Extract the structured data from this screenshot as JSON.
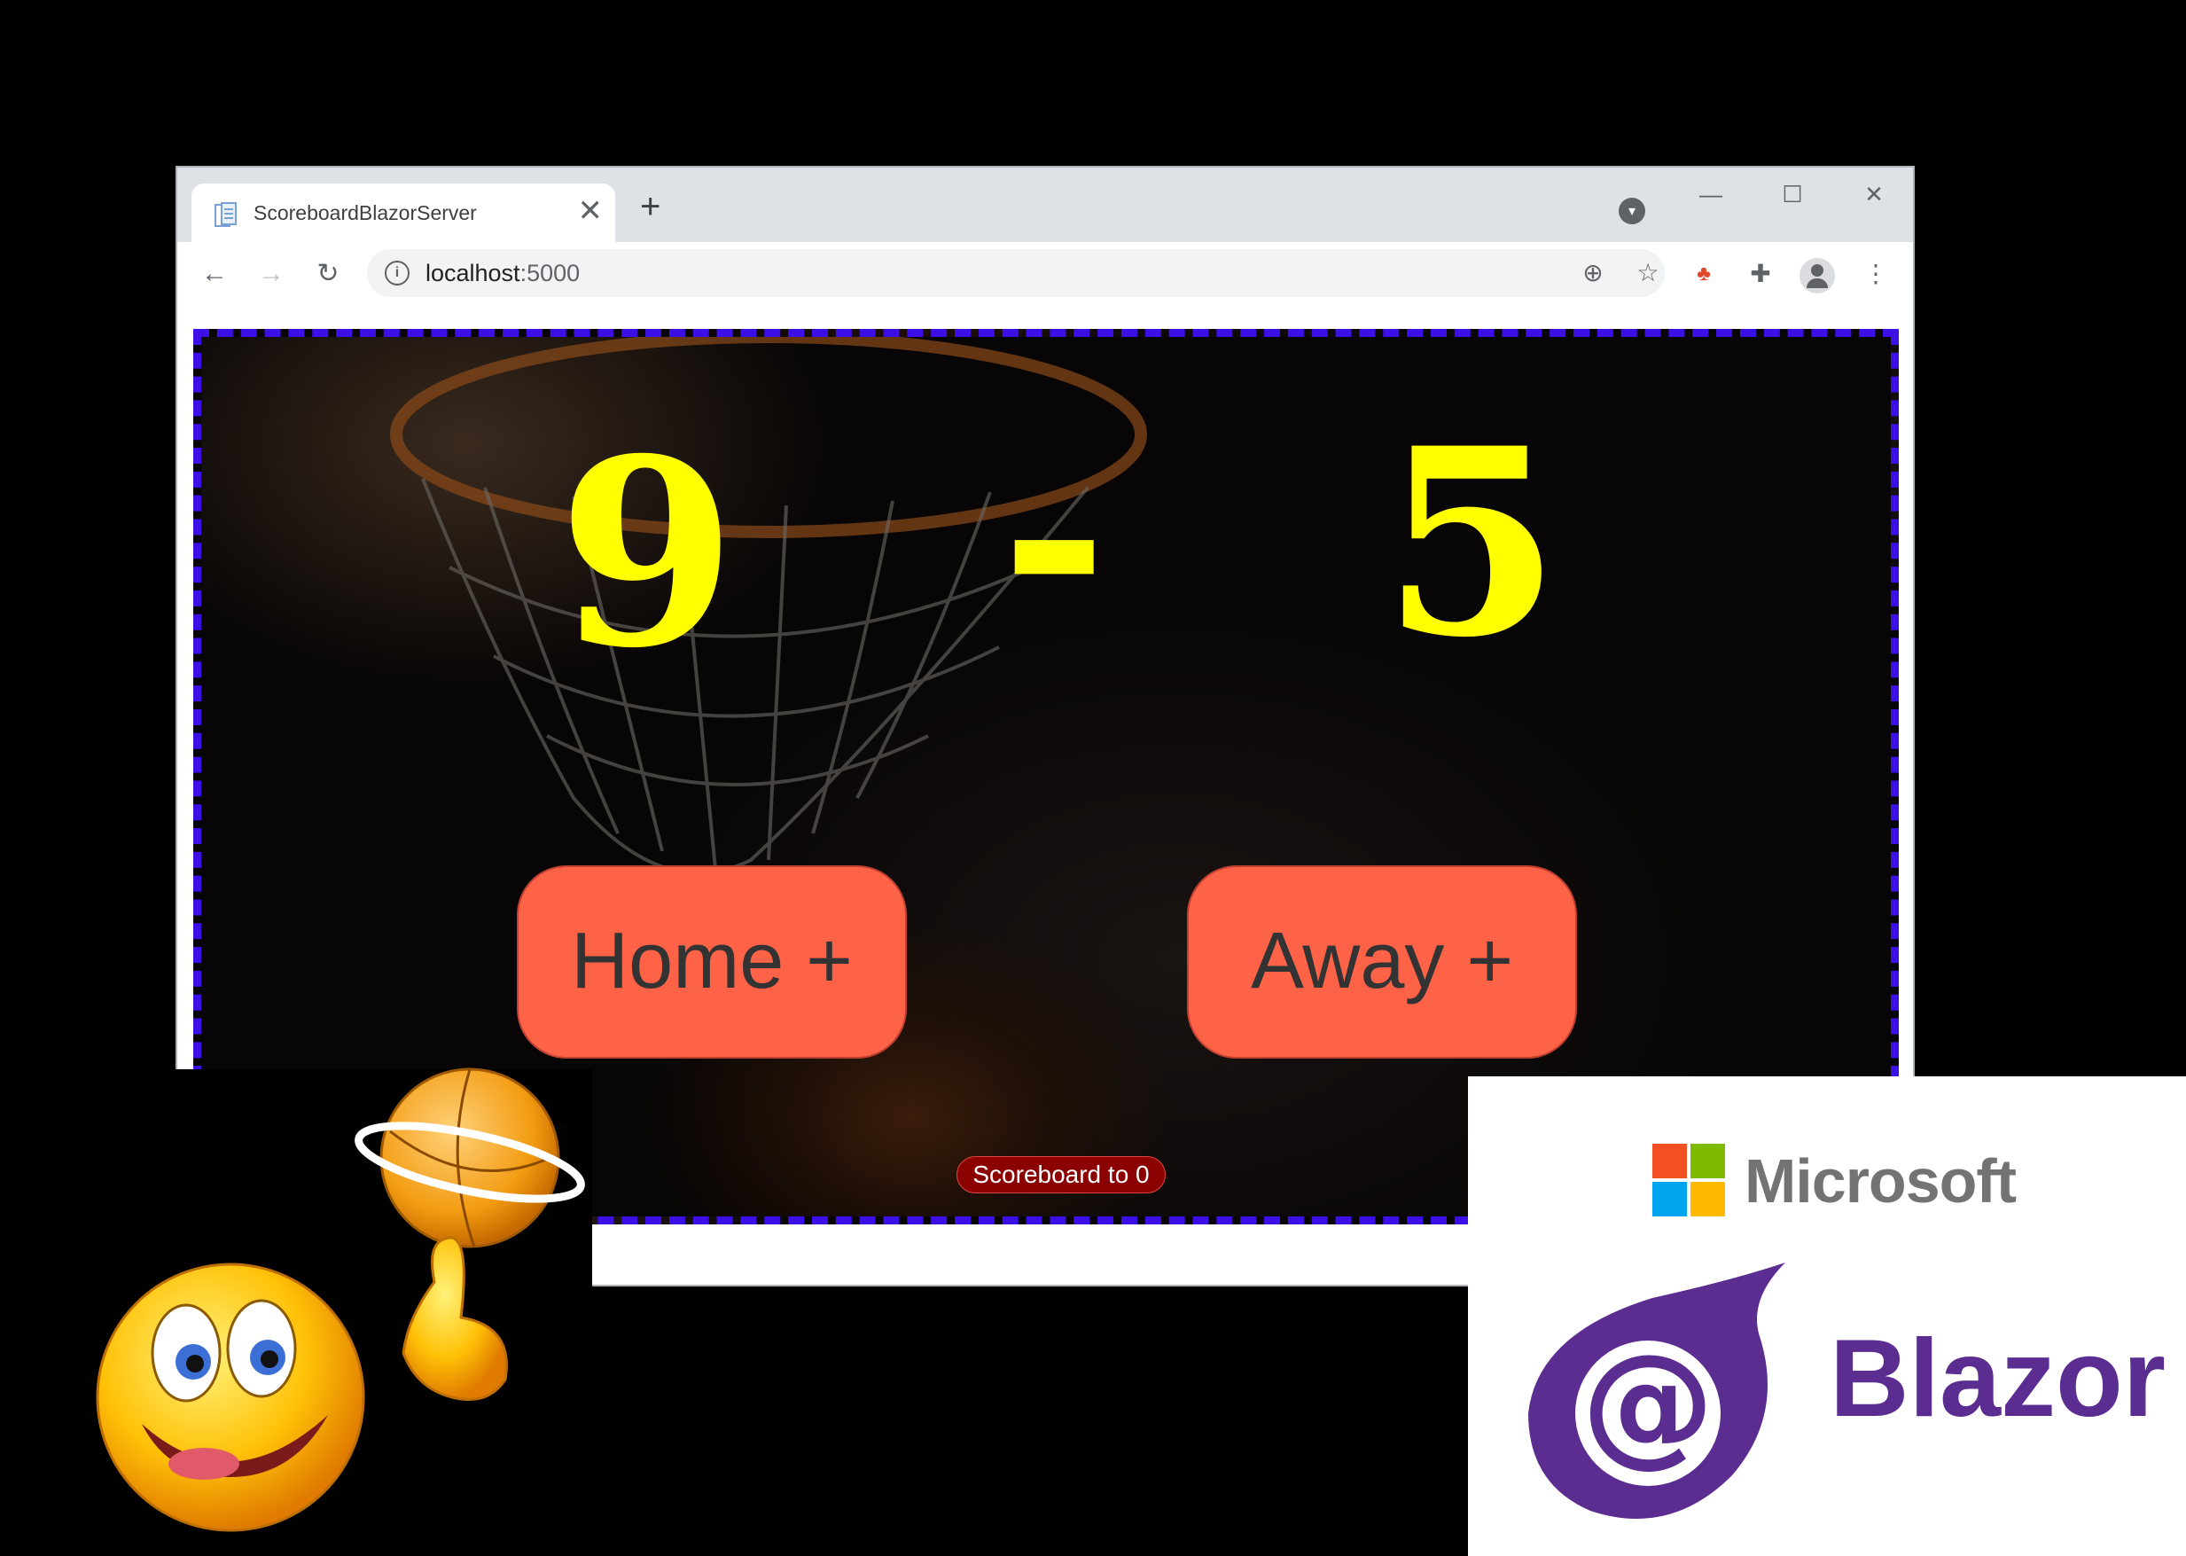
{
  "browser": {
    "tab_title": "ScoreboardBlazorServer",
    "tab_close": "✕",
    "new_tab": "+",
    "url_host": "localhost",
    "url_port": ":5000"
  },
  "scoreboard": {
    "home_score": "9",
    "separator": "-",
    "away_score": "5",
    "home_button": "Home +",
    "away_button": "Away +",
    "reset_button": "Scoreboard to 0"
  },
  "logos": {
    "microsoft": "Microsoft",
    "blazor": "Blazor"
  },
  "colors": {
    "score": "#ffff00",
    "buttons": "#ff6347",
    "reset": "#8b0000",
    "border": "#3b0fe6",
    "blazor_purple": "#5c2d91"
  }
}
